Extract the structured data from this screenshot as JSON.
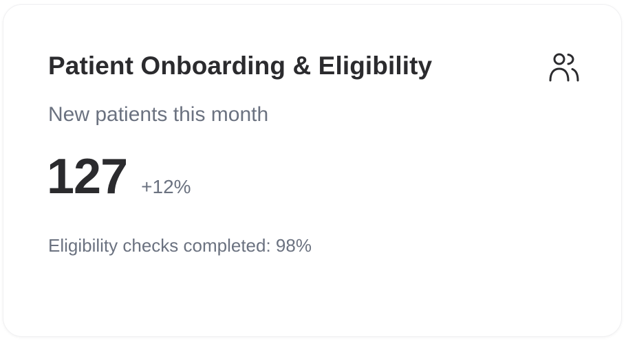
{
  "card": {
    "title": "Patient Onboarding & Eligibility",
    "icon": "users-icon",
    "subtitle": "New patients this month",
    "metric": {
      "value": "127",
      "change": "+12%"
    },
    "footnote": "Eligibility checks completed: 98%"
  },
  "colors": {
    "title": "#2b2b2e",
    "muted": "#6b7280",
    "card_background": "#ffffff"
  }
}
